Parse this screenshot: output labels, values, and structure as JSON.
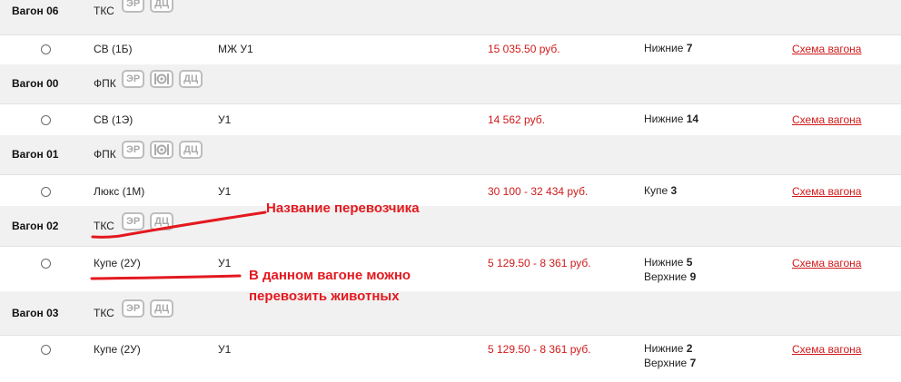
{
  "schema_label": "Схема вагона",
  "badges": {
    "er": "ЭР",
    "dc": "ДЦ",
    "meal_icon": "meal-plate-icon"
  },
  "wagons": [
    {
      "number": "Вагон 06",
      "carrier": "ТКС",
      "class": "СВ (1Б)",
      "service": "МЖ У1",
      "price": "15 035.50 руб.",
      "seats": [
        {
          "label": "Нижние",
          "count": "7"
        }
      ]
    },
    {
      "number": "Вагон 00",
      "carrier": "ФПК",
      "class": "СВ (1Э)",
      "service": "У1",
      "price": "14 562 руб.",
      "seats": [
        {
          "label": "Нижние",
          "count": "14"
        }
      ]
    },
    {
      "number": "Вагон 01",
      "carrier": "ФПК",
      "class": "Люкс (1М)",
      "service": "У1",
      "price": "30 100 - 32 434 руб.",
      "seats": [
        {
          "label": "Купе",
          "count": "3"
        }
      ]
    },
    {
      "number": "Вагон 02",
      "carrier": "ТКС",
      "class": "Купе (2У)",
      "service": "У1",
      "price": "5 129.50 - 8 361 руб.",
      "seats": [
        {
          "label": "Нижние",
          "count": "5"
        },
        {
          "label": "Верхние",
          "count": "9"
        }
      ]
    },
    {
      "number": "Вагон 03",
      "carrier": "ТКС",
      "class": "Купе (2У)",
      "service": "У1",
      "price": "5 129.50 - 8 361 руб.",
      "seats": [
        {
          "label": "Нижние",
          "count": "2"
        },
        {
          "label": "Верхние",
          "count": "7"
        }
      ]
    }
  ],
  "annotations": {
    "carrier_note": "Название перевозчика",
    "animals_note_line1": "В данном вагоне можно",
    "animals_note_line2": "перевозить животных"
  },
  "colors": {
    "accent_red": "#d01a1a",
    "annotation_red": "#e3191f",
    "row_gray": "#f1f1f1"
  }
}
